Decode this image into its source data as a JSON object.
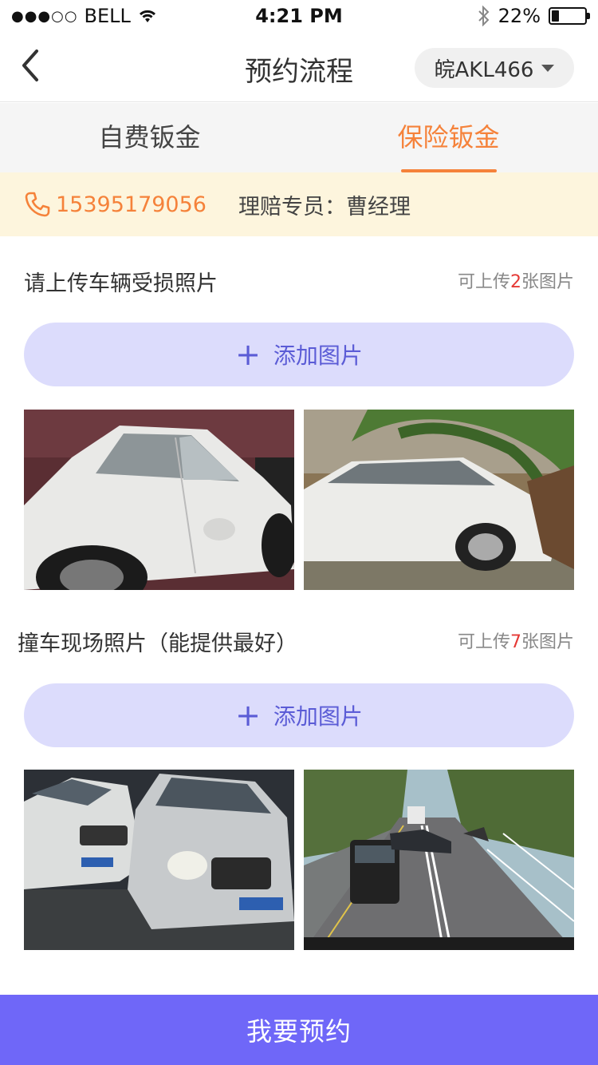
{
  "statusbar": {
    "carrier": "BELL",
    "time": "4:21 PM",
    "battery": "22%",
    "signal_dots": "●●●○○",
    "battery_level": 0.22
  },
  "nav": {
    "title": "预约流程",
    "plate": "皖AKL466"
  },
  "tabs": [
    {
      "label": "自费钣金",
      "active": false
    },
    {
      "label": "保险钣金",
      "active": true
    }
  ],
  "contact": {
    "phone": "15395179056",
    "agent": "理赔专员：曹经理"
  },
  "sections": [
    {
      "title": "请上传车辆受损照片",
      "limit_prefix": "可上传",
      "limit_num": "2",
      "limit_suffix": "张图片",
      "add_label": "添加图片",
      "photos": [
        "damaged-white-sedan-door",
        "white-car-crushed-by-tree"
      ]
    },
    {
      "title": "撞车现场照片（能提供最好）",
      "limit_prefix": "可上传",
      "limit_num": "7",
      "limit_suffix": "张图片",
      "add_label": "添加图片",
      "photos": [
        "two-cars-collision",
        "road-accident-scene"
      ]
    }
  ],
  "submit_label": "我要预约",
  "colors": {
    "accent": "#f5823a",
    "primary": "#6f67f8",
    "add_bg": "#dcdcfc",
    "tip_bg": "#fdf5dd"
  }
}
